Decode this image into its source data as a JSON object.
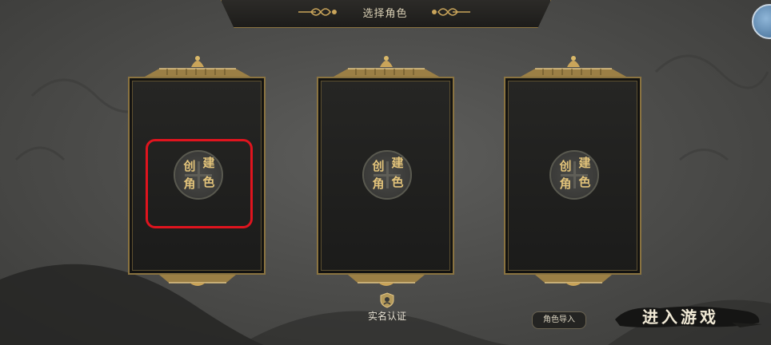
{
  "header": {
    "title": "选择角色"
  },
  "slots": [
    {
      "create_chars": [
        "创",
        "建",
        "角",
        "色"
      ]
    },
    {
      "create_chars": [
        "创",
        "建",
        "角",
        "色"
      ]
    },
    {
      "create_chars": [
        "创",
        "建",
        "角",
        "色"
      ]
    }
  ],
  "footer": {
    "real_name_label": "实名认证",
    "import_label": "角色导入",
    "enter_label": "进入游戏"
  },
  "colors": {
    "gold": "#c9a45a",
    "highlight": "#e0141e"
  }
}
